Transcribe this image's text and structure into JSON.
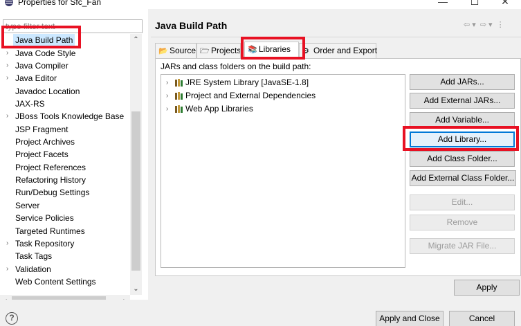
{
  "window": {
    "title": "Properties for Sfc_Fan",
    "minimize_icon": "minimize-icon",
    "maximize_icon": "maximize-icon",
    "close_icon": "close-icon"
  },
  "filter": {
    "placeholder": "type filter text"
  },
  "tree": {
    "items": [
      {
        "label": "Java Build Path",
        "expandable": false,
        "selected": true
      },
      {
        "label": "Java Code Style",
        "expandable": true
      },
      {
        "label": "Java Compiler",
        "expandable": true
      },
      {
        "label": "Java Editor",
        "expandable": true
      },
      {
        "label": "Javadoc Location",
        "expandable": false
      },
      {
        "label": "JAX-RS",
        "expandable": false
      },
      {
        "label": "JBoss Tools Knowledge Base",
        "expandable": true
      },
      {
        "label": "JSP Fragment",
        "expandable": false
      },
      {
        "label": "Project Archives",
        "expandable": false
      },
      {
        "label": "Project Facets",
        "expandable": false
      },
      {
        "label": "Project References",
        "expandable": false
      },
      {
        "label": "Refactoring History",
        "expandable": false
      },
      {
        "label": "Run/Debug Settings",
        "expandable": false
      },
      {
        "label": "Server",
        "expandable": false
      },
      {
        "label": "Service Policies",
        "expandable": false
      },
      {
        "label": "Targeted Runtimes",
        "expandable": false
      },
      {
        "label": "Task Repository",
        "expandable": true
      },
      {
        "label": "Task Tags",
        "expandable": false
      },
      {
        "label": "Validation",
        "expandable": true
      },
      {
        "label": "Web Content Settings",
        "expandable": false
      }
    ]
  },
  "page": {
    "title": "Java Build Path",
    "tabs": [
      {
        "label": "Source",
        "icon": "source-folder-icon"
      },
      {
        "label": "Projects",
        "icon": "projects-icon"
      },
      {
        "label": "Libraries",
        "icon": "libraries-icon",
        "active": true
      },
      {
        "label": "Order and Export",
        "icon": "order-export-icon"
      }
    ],
    "list_caption": "JARs and class folders on the build path:",
    "libraries": [
      "JRE System Library [JavaSE-1.8]",
      "Project and External Dependencies",
      "Web App Libraries"
    ],
    "buttons": {
      "add_jars": "Add JARs...",
      "add_external_jars": "Add External JARs...",
      "add_variable": "Add Variable...",
      "add_library": "Add Library...",
      "add_class_folder": "Add Class Folder...",
      "add_external_class_folder": "Add External Class Folder...",
      "edit": "Edit...",
      "remove": "Remove",
      "migrate_jar": "Migrate JAR File...",
      "apply": "Apply"
    }
  },
  "footer": {
    "help": "?",
    "apply_and_close": "Apply and Close",
    "cancel": "Cancel"
  },
  "colors": {
    "highlight_box": "#e81123",
    "selection": "#cce8ff",
    "focus": "#0078d7"
  }
}
